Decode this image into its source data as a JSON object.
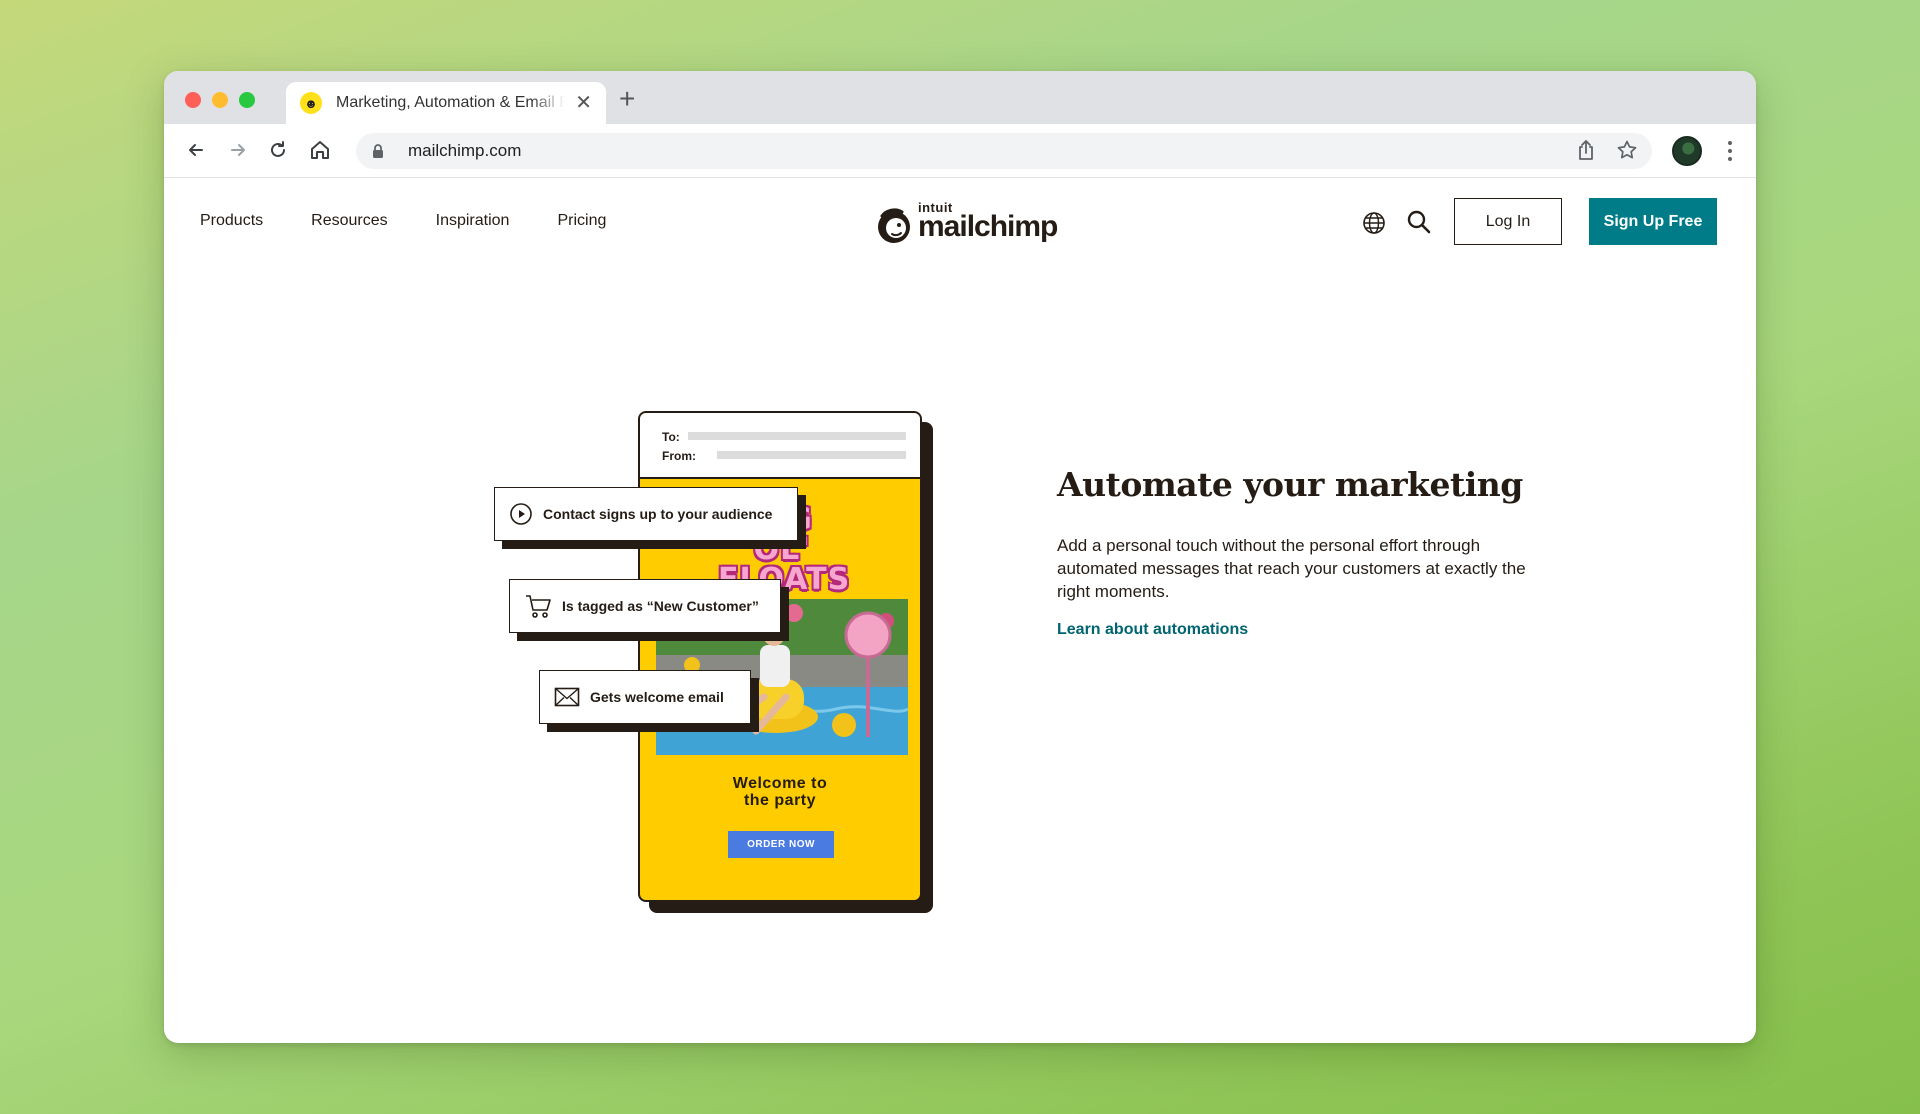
{
  "browser": {
    "tab_title": "Marketing, Automation & Email Platform",
    "new_tab_symbol": "+",
    "close_symbol": "✕",
    "url": "mailchimp.com",
    "favicon_glyph": "☻"
  },
  "nav": {
    "links": [
      "Products",
      "Resources",
      "Inspiration",
      "Pricing"
    ],
    "logo_small": "intuit",
    "logo_main": "mailchimp",
    "login_label": "Log In",
    "signup_label": "Sign Up Free"
  },
  "illustration": {
    "to_label": "To:",
    "from_label": "From:",
    "promo_line1": "BIG OL'",
    "promo_line2": "FLOATS",
    "welcome_line1": "Welcome to",
    "welcome_line2": "the party",
    "order_label": "ORDER NOW",
    "steps": [
      {
        "label": "Contact signs up to your audience",
        "icon": "play-circle-icon"
      },
      {
        "label": "Is tagged as “New Customer”",
        "icon": "cart-icon"
      },
      {
        "label": "Gets welcome email",
        "icon": "envelope-icon"
      }
    ]
  },
  "hero": {
    "headline": "Automate your marketing",
    "body": "Add a personal touch without the personal effort through automated messages that reach your customers at exactly the right moments.",
    "link": "Learn about automations"
  },
  "colors": {
    "brand_teal": "#007c89",
    "phone_yellow": "#ffcc00",
    "ink": "#241c15",
    "button_blue": "#4a7be0"
  }
}
